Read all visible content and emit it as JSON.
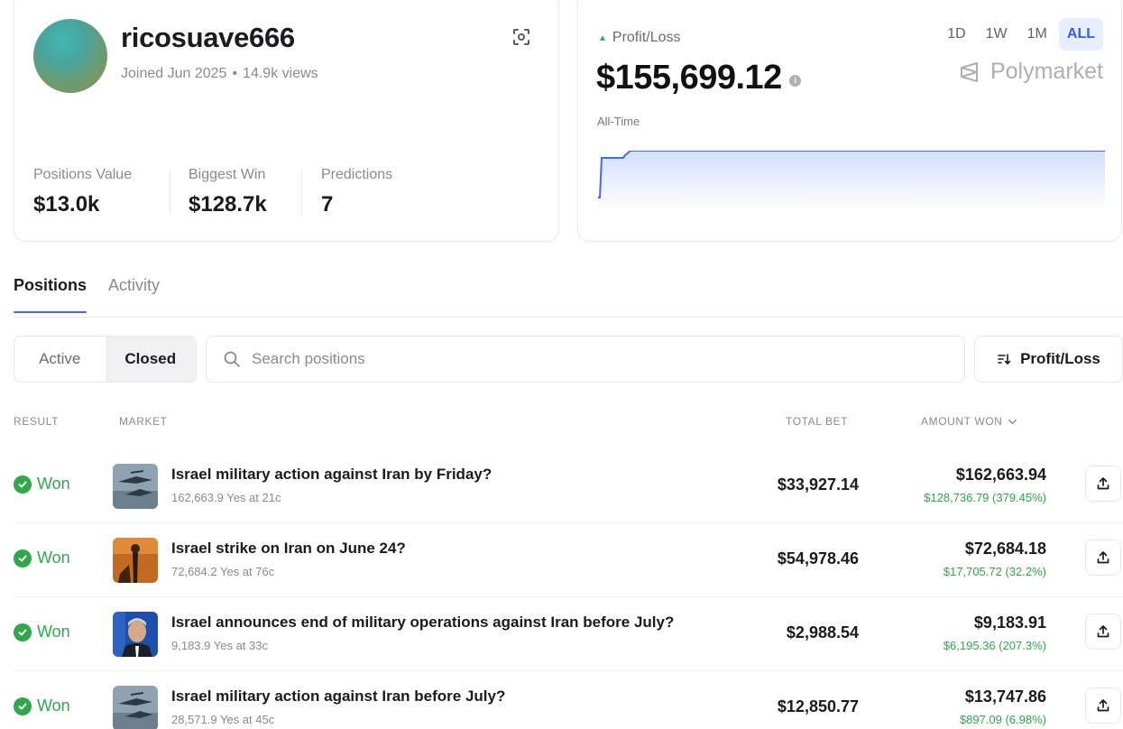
{
  "profile": {
    "username": "ricosuave666",
    "joined": "Joined Jun 2025",
    "views": "14.9k views",
    "stats": [
      {
        "label": "Positions Value",
        "value": "$13.0k"
      },
      {
        "label": "Biggest Win",
        "value": "$128.7k"
      },
      {
        "label": "Predictions",
        "value": "7"
      }
    ]
  },
  "pnl": {
    "label": "Profit/Loss",
    "value": "$155,699.12",
    "period": "All-Time",
    "ranges": [
      "1D",
      "1W",
      "1M",
      "ALL"
    ],
    "active_range": "ALL",
    "brand": "Polymarket",
    "accent": "#3b6cf3"
  },
  "tabs": [
    "Positions",
    "Activity"
  ],
  "filters": {
    "segments": [
      "Active",
      "Closed"
    ],
    "active_segment": "Closed",
    "search_placeholder": "Search positions",
    "sort_label": "Profit/Loss"
  },
  "table": {
    "headers": {
      "result": "RESULT",
      "market": "MARKET",
      "total_bet": "TOTAL BET",
      "amount_won": "AMOUNT WON"
    },
    "rows": [
      {
        "result": "Won",
        "title": "Israel military action against Iran by Friday?",
        "sub": "162,663.9 Yes at 21c",
        "bet": "$33,927.14",
        "won": "$162,663.94",
        "gain": "$128,736.79 (379.45%)",
        "thumb": "jets"
      },
      {
        "result": "Won",
        "title": "Israel strike on Iran on June 24?",
        "sub": "72,684.2 Yes at 76c",
        "bet": "$54,978.46",
        "won": "$72,684.18",
        "gain": "$17,705.72 (32.2%)",
        "thumb": "missile"
      },
      {
        "result": "Won",
        "title": "Israel announces end of military operations against Iran before July?",
        "sub": "9,183.9 Yes at 33c",
        "bet": "$2,988.54",
        "won": "$9,183.91",
        "gain": "$6,195.36 (207.3%)",
        "thumb": "portrait"
      },
      {
        "result": "Won",
        "title": "Israel military action against Iran before July?",
        "sub": "28,571.9 Yes at 45c",
        "bet": "$12,850.77",
        "won": "$13,747.86",
        "gain": "$897.09 (6.98%)",
        "thumb": "jets"
      }
    ]
  },
  "colors": {
    "positive": "#2fa84a",
    "accent": "#3b6cf3",
    "active_range_bg": "#e6eeff"
  }
}
